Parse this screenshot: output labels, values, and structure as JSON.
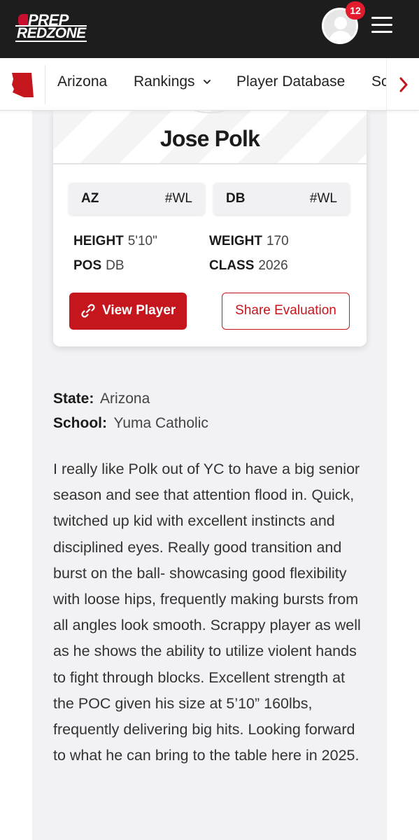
{
  "header": {
    "logo_top": "PREP",
    "logo_bottom": "REDZONE",
    "notification_count": "12",
    "icons": [
      "avatar-icon",
      "hamburger-menu-icon"
    ]
  },
  "nav": {
    "items": [
      "Arizona",
      "Rankings",
      "Player Database",
      "Sc"
    ],
    "state_icon": "arizona-state-icon",
    "scroll_icon": "chevron-right-icon",
    "dropdown_icon": "chevron-down-icon",
    "accent_color": "#c5161d"
  },
  "card": {
    "name": "Jose Polk",
    "pills": [
      {
        "left": "AZ",
        "right": "#WL"
      },
      {
        "left": "DB",
        "right": "#WL"
      }
    ],
    "stats": {
      "height_label": "HEIGHT",
      "height_value": "5'10\"",
      "weight_label": "WEIGHT",
      "weight_value": "170",
      "pos_label": "POS",
      "pos_value": "DB",
      "class_label": "CLASS",
      "class_value": "2026"
    },
    "view_button": "View Player",
    "share_button": "Share Evaluation"
  },
  "details": {
    "state_label": "State:",
    "state_value": "Arizona",
    "school_label": "School:",
    "school_value": "Yuma Catholic"
  },
  "evaluation": "I really like Polk out of YC to have a big senior season and see that attention flood in. Quick, twitched up kid with excellent instincts and disciplined eyes. Really good transition and burst on the ball- showcasing good flexibility with loose hips, frequently making bursts from all angles look smooth. Scrappy player as well as he shows the ability to utilize violent hands to fight through blocks. Excellent strength at the POC given his size at 5’10” 160lbs, frequently delivering big hits. Looking forward to what he can bring to the table here in 2025."
}
